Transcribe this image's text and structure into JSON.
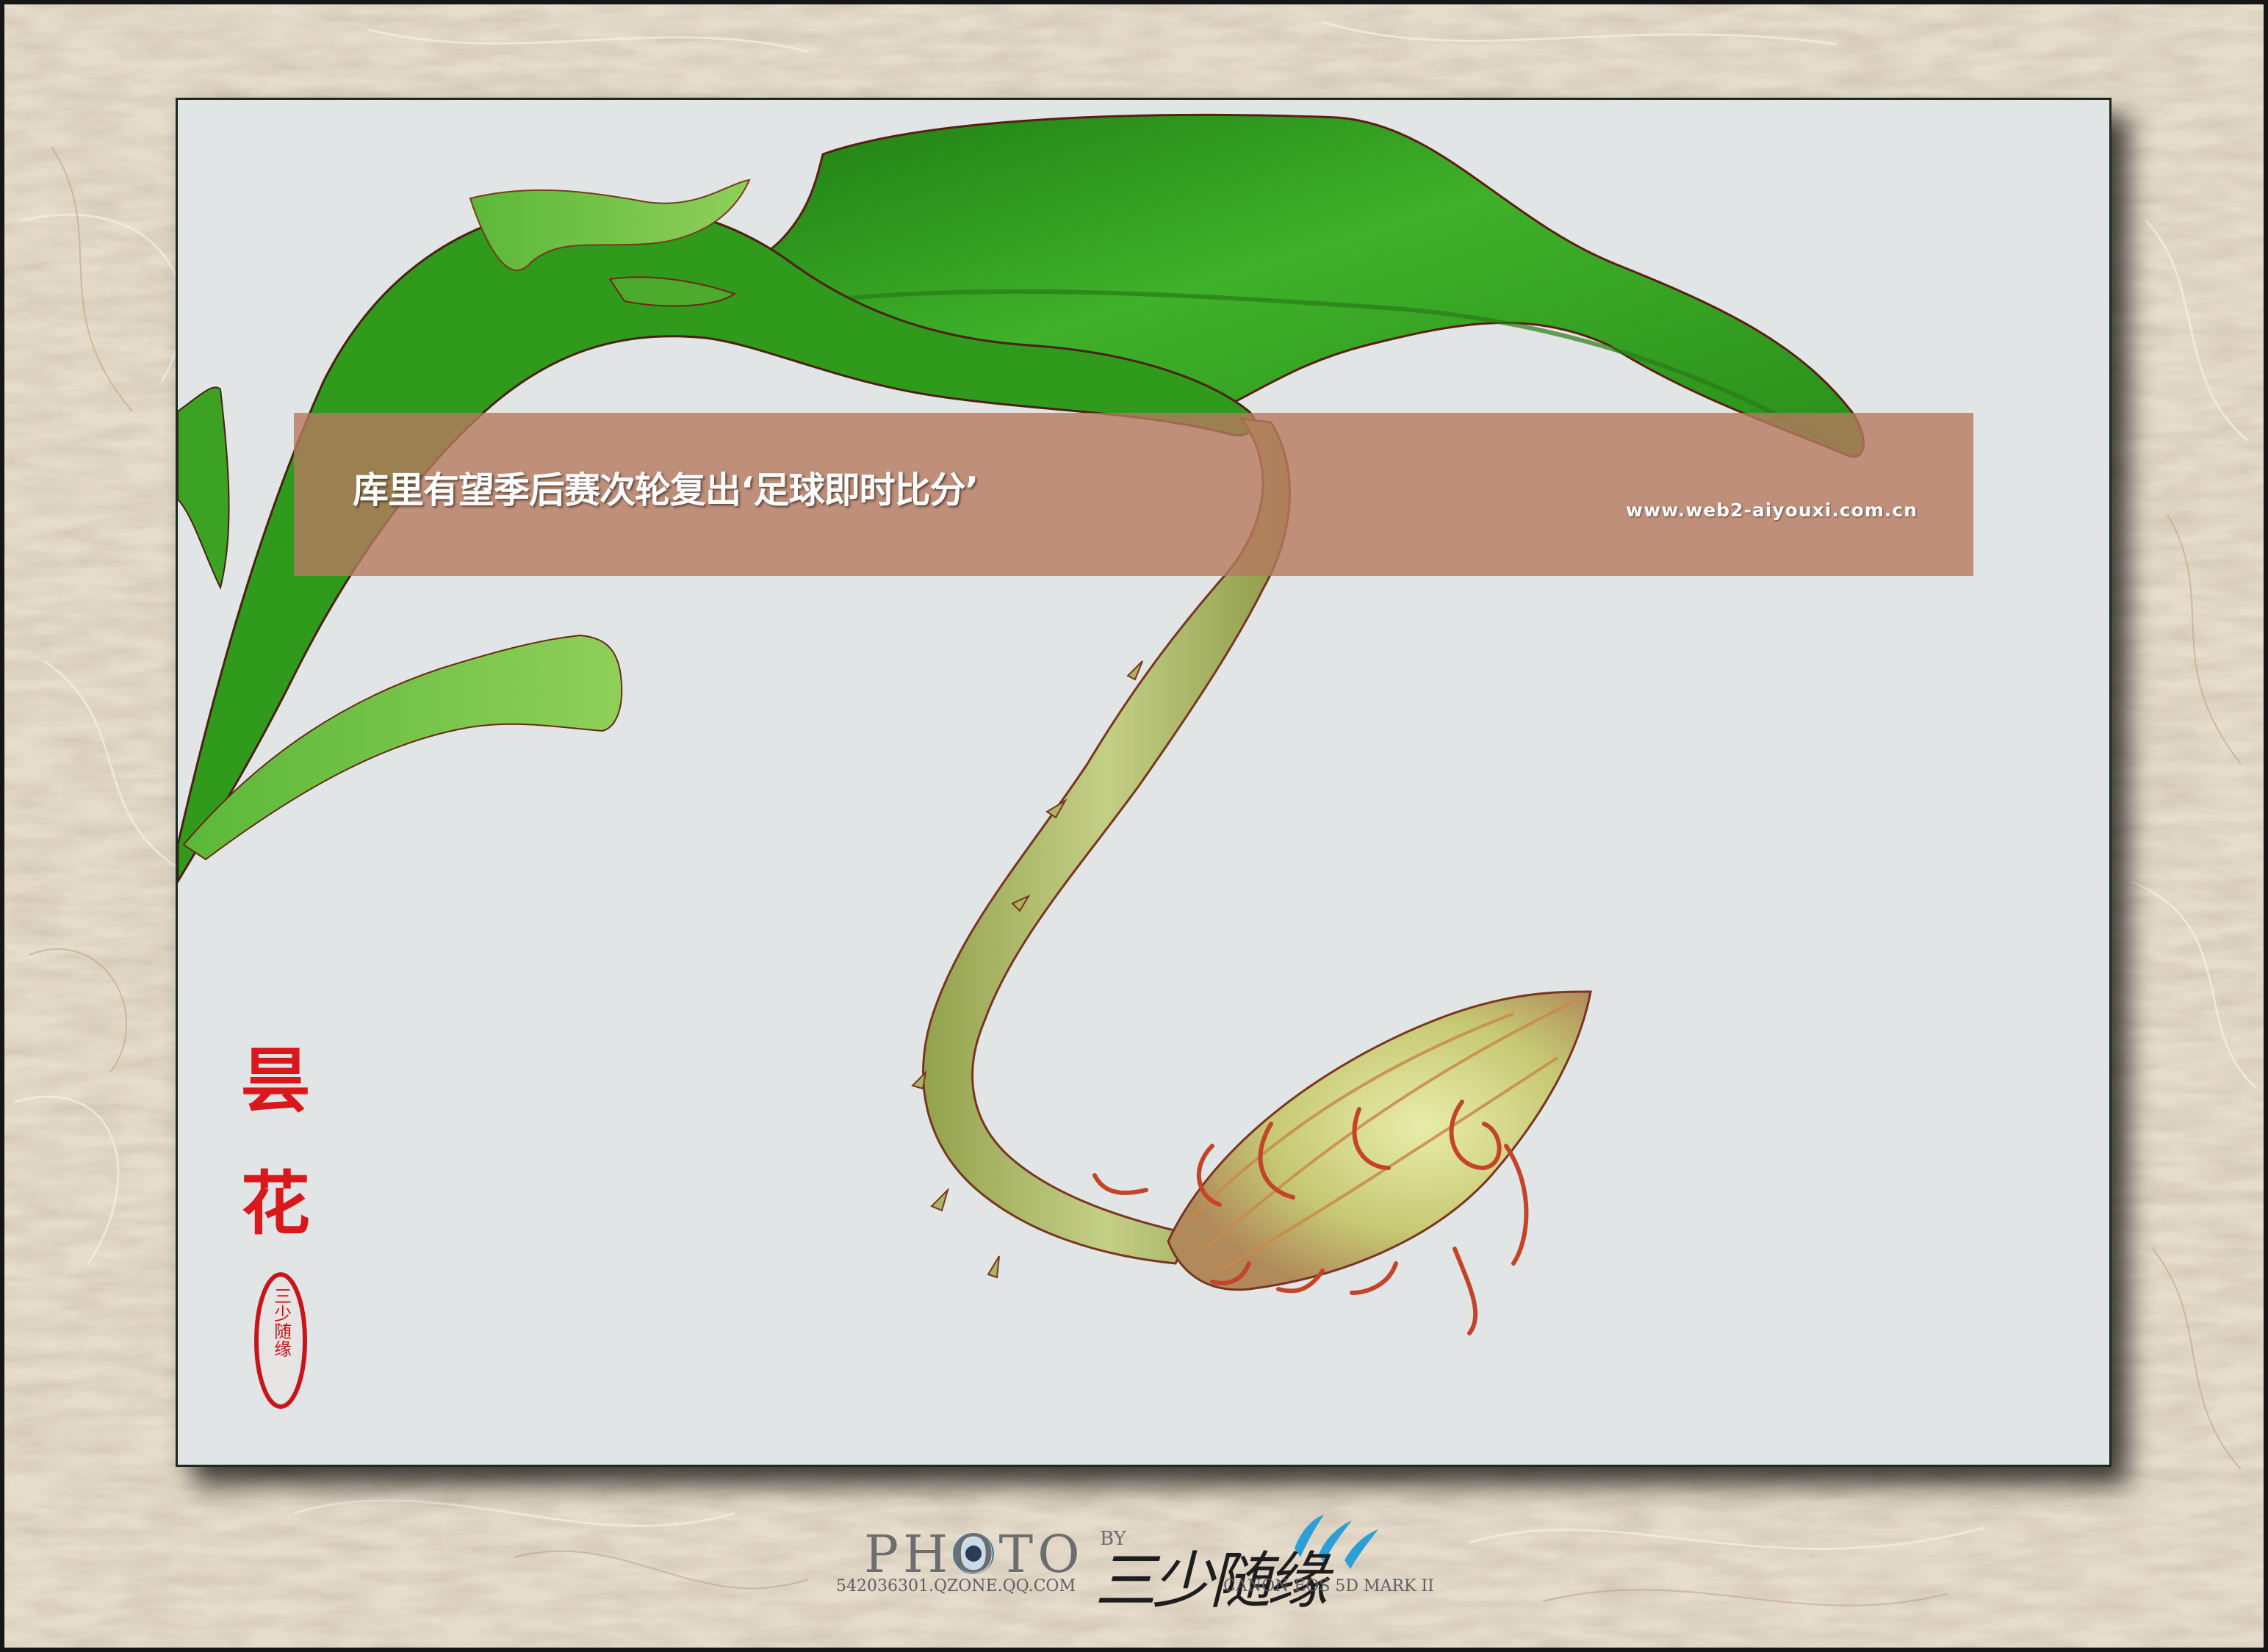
{
  "banner": {
    "title": "库里有望季后赛次轮复出‘足球即时比分’",
    "url": "www.web2-aiyouxi.com.cn"
  },
  "poem": {
    "char1": "昙",
    "char2": "花"
  },
  "seal": {
    "text": "三少随缘"
  },
  "footer": {
    "photo_word": "PHOTO",
    "by": "BY",
    "signature": "三少随缘",
    "qzone": "542036301.QZONE.QQ.COM",
    "camera": "CANON EOS 5D MARK II"
  },
  "colors": {
    "paper": "#e9dfcf",
    "photo_bg": "#e1e5e5",
    "banner": "#b7795f",
    "leaf": "#2f9a1c",
    "bud": "#b9c46b",
    "seal_red": "#d8181a"
  }
}
